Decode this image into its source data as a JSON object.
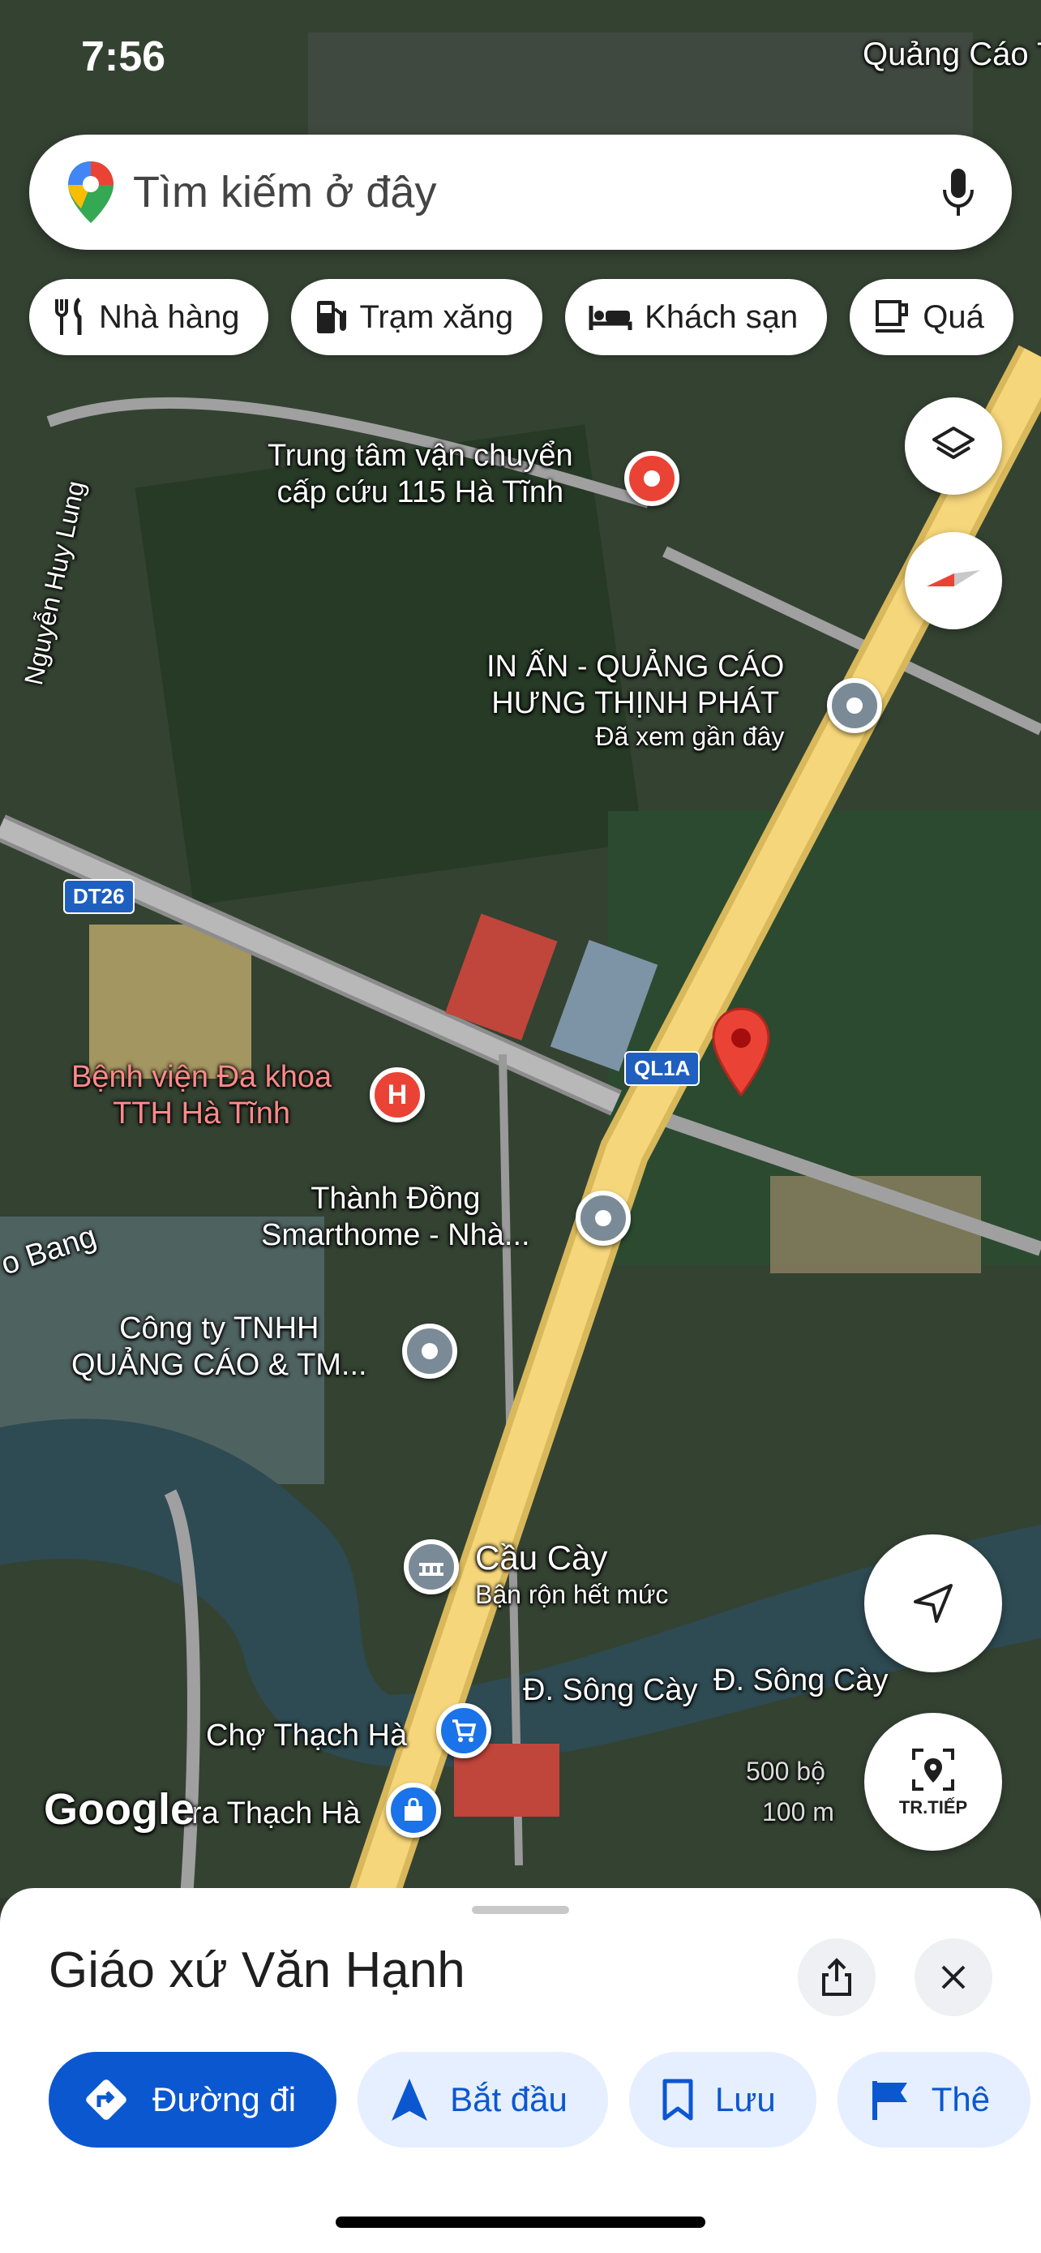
{
  "status": {
    "time": "7:56",
    "right_text": "Quảng Cáo T"
  },
  "search": {
    "placeholder": "Tìm kiếm ở đây"
  },
  "chips": [
    {
      "label": "Nhà hàng",
      "icon": "fork-knife-icon"
    },
    {
      "label": "Trạm xăng",
      "icon": "gas-station-icon"
    },
    {
      "label": "Khách sạn",
      "icon": "bed-icon"
    },
    {
      "label": "Quá",
      "icon": "coffee-cup-icon"
    }
  ],
  "map": {
    "street_labels": {
      "nguyen_huy_lung": "Nguyễn Huy Lung",
      "dt26": "DT26",
      "ql1a": "QL1A",
      "song_cay_1": "Đ. Sông Cày",
      "song_cay_2": "Đ. Sông Cày",
      "bang": "o Bang",
      "scale_1": "500 bộ",
      "scale_2": "100 m"
    },
    "places": {
      "ems": {
        "line1": "Trung tâm vận chuyển",
        "line2": "cấp cứu 115 Hà Tĩnh"
      },
      "print": {
        "line1": "IN ẤN - QUẢNG CÁO",
        "line2": "HƯNG THỊNH PHÁT",
        "note": "Đã xem gần đây"
      },
      "hospital": {
        "line1": "Bệnh viện Đa khoa",
        "line2": "TTH Hà Tĩnh"
      },
      "smarthome": {
        "line1": "Thành Đồng",
        "line2": "Smarthome - Nhà..."
      },
      "company": {
        "line1": "Công ty TNHH",
        "line2": "QUẢNG CÁO & TM..."
      },
      "bridge": {
        "line1": "Cầu Cày",
        "note": "Bận rộn hết mức"
      },
      "market": {
        "line1": "Chợ Thạch Hà"
      },
      "shop": {
        "line1": "ra Thạch Hà"
      }
    },
    "google_logo": "Google",
    "next_label": "TR.TIẾP"
  },
  "sheet": {
    "title": "Giáo xứ Văn Hạnh",
    "actions": [
      {
        "label": "Đường đi"
      },
      {
        "label": "Bắt đầu"
      },
      {
        "label": "Lưu"
      },
      {
        "label": "Thê"
      }
    ]
  },
  "colors": {
    "accent": "#0b57d0",
    "pin_red": "#ea4335",
    "road_yellow": "#f6d67a"
  }
}
